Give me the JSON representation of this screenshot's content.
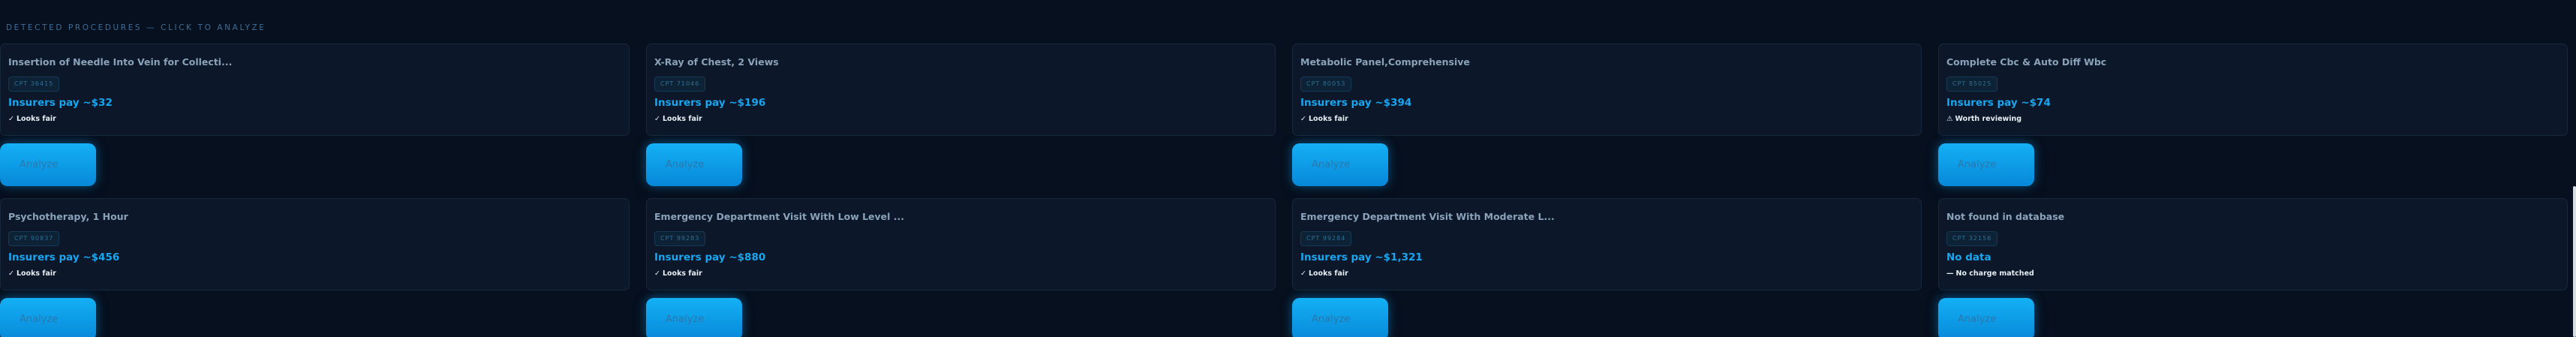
{
  "section_label": "DETECTED PROCEDURES — CLICK TO ANALYZE",
  "analyze_label": "Analyze",
  "cards": [
    {
      "title": "Insertion of Needle Into Vein for Collecti...",
      "cpt": "CPT 36415",
      "price": "Insurers pay ~$32",
      "verdict_icon": "✓",
      "verdict": "Looks fair"
    },
    {
      "title": "X-Ray of Chest, 2 Views",
      "cpt": "CPT 71046",
      "price": "Insurers pay ~$196",
      "verdict_icon": "✓",
      "verdict": "Looks fair"
    },
    {
      "title": "Metabolic Panel,Comprehensive",
      "cpt": "CPT 80053",
      "price": "Insurers pay ~$394",
      "verdict_icon": "✓",
      "verdict": "Looks fair"
    },
    {
      "title": "Complete Cbc & Auto Diff Wbc",
      "cpt": "CPT 85025",
      "price": "Insurers pay ~$74",
      "verdict_icon": "⚠",
      "verdict": "Worth reviewing"
    },
    {
      "title": "Psychotherapy, 1 Hour",
      "cpt": "CPT 90837",
      "price": "Insurers pay ~$456",
      "verdict_icon": "✓",
      "verdict": "Looks fair"
    },
    {
      "title": "Emergency Department Visit With Low Level ...",
      "cpt": "CPT 99283",
      "price": "Insurers pay ~$880",
      "verdict_icon": "✓",
      "verdict": "Looks fair"
    },
    {
      "title": "Emergency Department Visit With Moderate L...",
      "cpt": "CPT 99284",
      "price": "Insurers pay ~$1,321",
      "verdict_icon": "✓",
      "verdict": "Looks fair"
    },
    {
      "title": "Not found in database",
      "cpt": "CPT 32156",
      "price": "No data",
      "verdict_icon": "—",
      "verdict": "No charge matched"
    }
  ]
}
